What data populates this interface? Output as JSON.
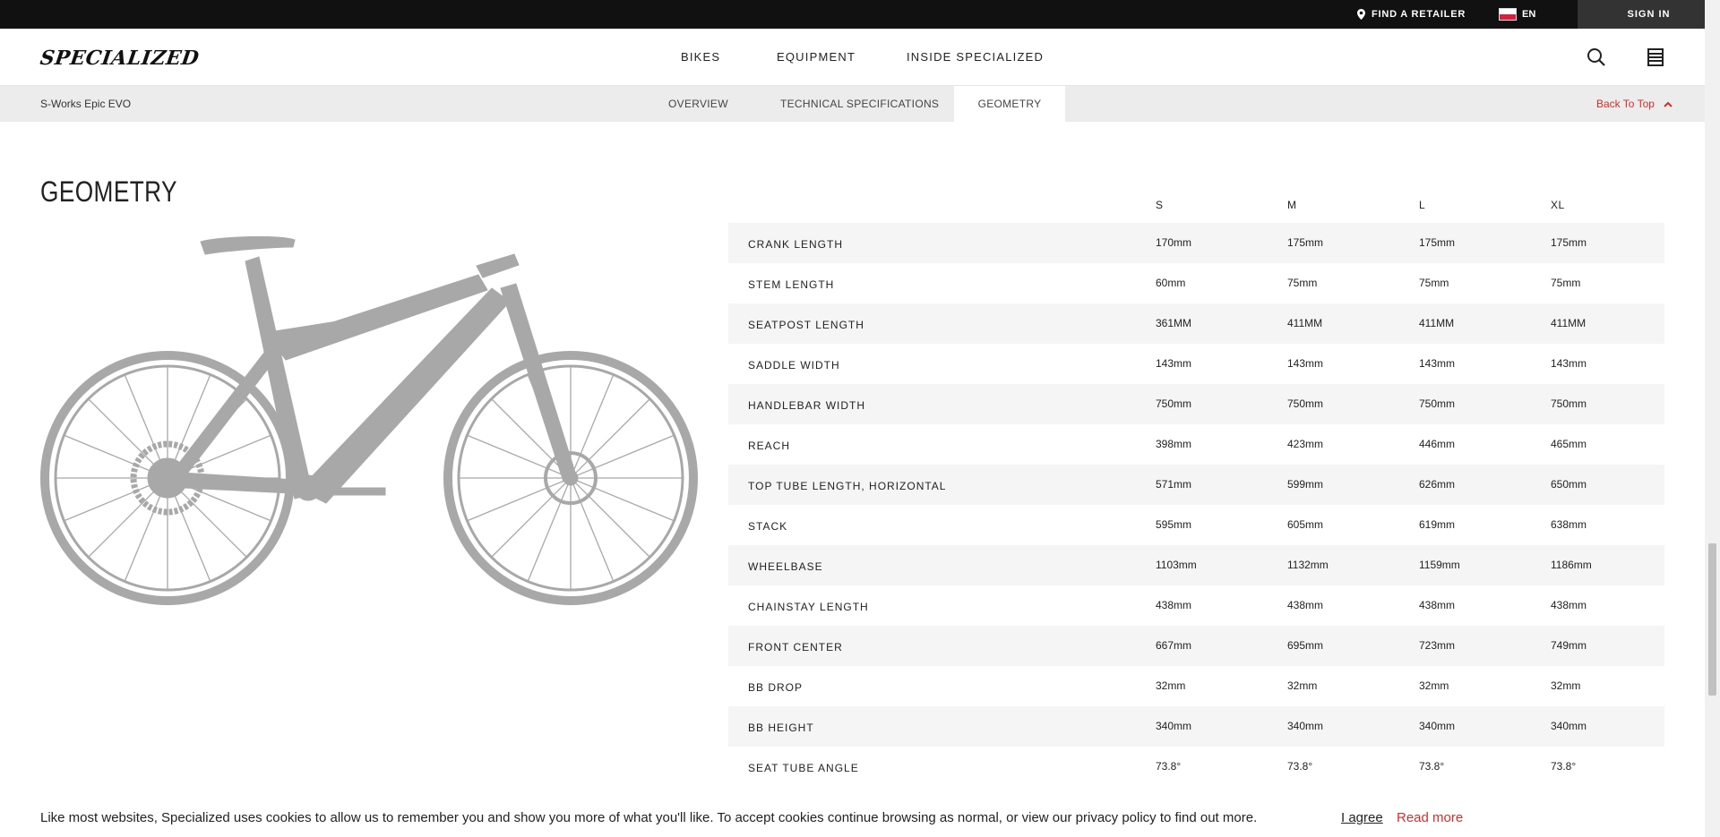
{
  "utility_bar": {
    "retailer_label": "FIND A RETAILER",
    "language": "EN",
    "signin_label": "SIGN IN"
  },
  "header": {
    "logo_text": "SPECIALIZED",
    "nav": [
      "BIKES",
      "EQUIPMENT",
      "INSIDE SPECIALIZED"
    ]
  },
  "subnav": {
    "product_name": "S-Works Epic EVO",
    "tabs": [
      "OVERVIEW",
      "TECHNICAL SPECIFICATIONS",
      "GEOMETRY"
    ],
    "active_tab": "GEOMETRY",
    "back_to_top": "Back To Top"
  },
  "geometry": {
    "title": "GEOMETRY",
    "sizes": [
      "S",
      "M",
      "L",
      "XL"
    ],
    "rows": [
      {
        "label": "CRANK LENGTH",
        "values": [
          "170mm",
          "175mm",
          "175mm",
          "175mm"
        ]
      },
      {
        "label": "STEM LENGTH",
        "values": [
          "60mm",
          "75mm",
          "75mm",
          "75mm"
        ]
      },
      {
        "label": "SEATPOST LENGTH",
        "values": [
          "361MM",
          "411MM",
          "411MM",
          "411MM"
        ]
      },
      {
        "label": "SADDLE WIDTH",
        "values": [
          "143mm",
          "143mm",
          "143mm",
          "143mm"
        ]
      },
      {
        "label": "HANDLEBAR WIDTH",
        "values": [
          "750mm",
          "750mm",
          "750mm",
          "750mm"
        ]
      },
      {
        "label": "REACH",
        "values": [
          "398mm",
          "423mm",
          "446mm",
          "465mm"
        ]
      },
      {
        "label": "TOP TUBE LENGTH, HORIZONTAL",
        "values": [
          "571mm",
          "599mm",
          "626mm",
          "650mm"
        ]
      },
      {
        "label": "STACK",
        "values": [
          "595mm",
          "605mm",
          "619mm",
          "638mm"
        ]
      },
      {
        "label": "WHEELBASE",
        "values": [
          "1103mm",
          "1132mm",
          "1159mm",
          "1186mm"
        ]
      },
      {
        "label": "CHAINSTAY LENGTH",
        "values": [
          "438mm",
          "438mm",
          "438mm",
          "438mm"
        ]
      },
      {
        "label": "FRONT CENTER",
        "values": [
          "667mm",
          "695mm",
          "723mm",
          "749mm"
        ]
      },
      {
        "label": "BB DROP",
        "values": [
          "32mm",
          "32mm",
          "32mm",
          "32mm"
        ]
      },
      {
        "label": "BB HEIGHT",
        "values": [
          "340mm",
          "340mm",
          "340mm",
          "340mm"
        ]
      },
      {
        "label": "SEAT TUBE ANGLE",
        "values": [
          "73.8°",
          "73.8°",
          "73.8°",
          "73.8°"
        ]
      }
    ]
  },
  "cookie": {
    "text": "Like most websites, Specialized uses cookies to allow us to remember you and show you more of what you'll like. To accept cookies continue browsing as normal, or view our privacy policy to find out more.",
    "agree_label": "I agree",
    "read_more_label": "Read more"
  },
  "colors": {
    "accent_red": "#d0312d",
    "topbar": "#111111",
    "subnav_bg": "#ececec",
    "row_shade": "#f5f5f5",
    "bike_gray": "#a8a8a8"
  },
  "icons": [
    "location-pin-icon",
    "flag-icon",
    "search-icon",
    "menu-icon",
    "chevron-up-icon",
    "bike-silhouette-icon"
  ]
}
